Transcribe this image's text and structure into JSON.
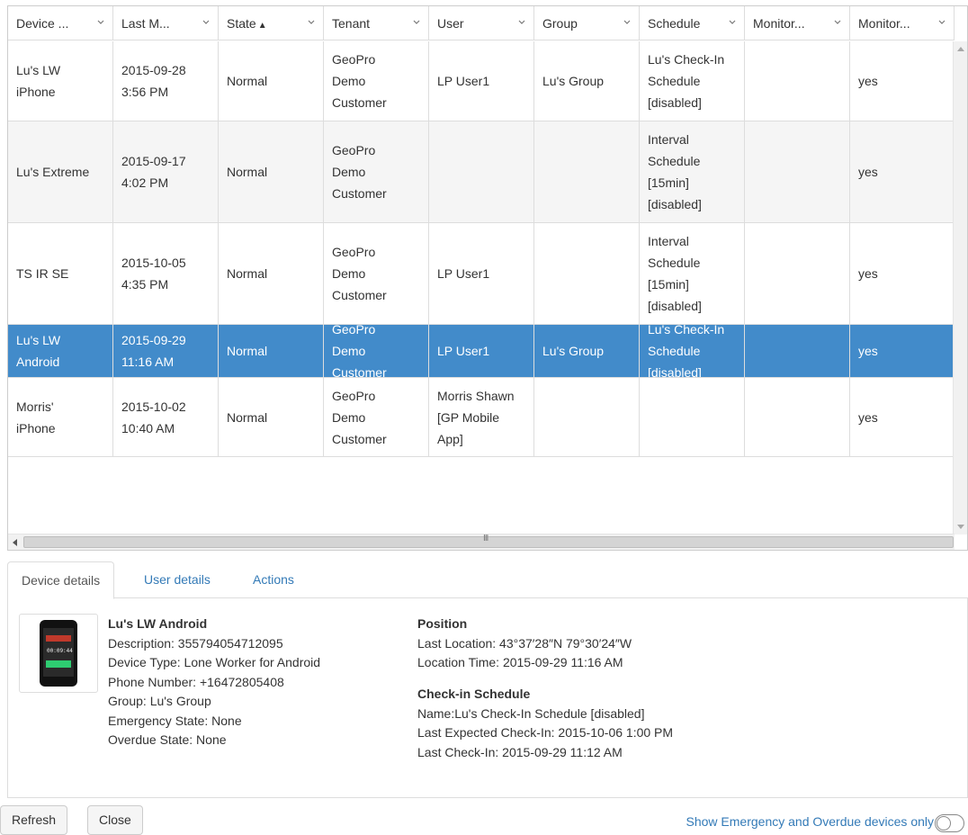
{
  "grid": {
    "columns": [
      {
        "label": "Device ...",
        "sort": ""
      },
      {
        "label": "Last M...",
        "sort": ""
      },
      {
        "label": "State",
        "sort": "▲"
      },
      {
        "label": "Tenant",
        "sort": ""
      },
      {
        "label": "User",
        "sort": ""
      },
      {
        "label": "Group",
        "sort": ""
      },
      {
        "label": "Schedule",
        "sort": ""
      },
      {
        "label": "Monitor...",
        "sort": ""
      },
      {
        "label": "Monitor...",
        "sort": ""
      }
    ],
    "rows": [
      {
        "cells": [
          "Lu's LW\niPhone",
          "2015-09-28\n3:56 PM",
          "Normal",
          "GeoPro\nDemo\nCustomer",
          "LP User1",
          "Lu's Group",
          "Lu's Check-In\nSchedule\n[disabled]",
          "",
          "yes"
        ]
      },
      {
        "cells": [
          "Lu's Extreme",
          "2015-09-17\n4:02 PM",
          "Normal",
          "GeoPro\nDemo\nCustomer",
          "",
          "",
          "Interval\nSchedule\n[15min]\n[disabled]",
          "",
          "yes"
        ]
      },
      {
        "cells": [
          "TS IR SE",
          "2015-10-05\n4:35 PM",
          "Normal",
          "GeoPro\nDemo\nCustomer",
          "LP User1",
          "",
          "Interval\nSchedule\n[15min]\n[disabled]",
          "",
          "yes"
        ]
      },
      {
        "cells": [
          "Lu's LW\nAndroid",
          "2015-09-29\n11:16 AM",
          "Normal",
          "GeoPro\nDemo\nCustomer",
          "LP User1",
          "Lu's Group",
          "Lu's Check-In\nSchedule\n[disabled]",
          "",
          "yes"
        ]
      },
      {
        "cells": [
          "Morris'\niPhone",
          "2015-10-02\n10:40 AM",
          "Normal",
          "GeoPro\nDemo\nCustomer",
          "Morris Shawn\n[GP Mobile\nApp]",
          "",
          "",
          "",
          "yes"
        ]
      }
    ],
    "selected_index": 3,
    "scroll_grip": "III"
  },
  "tabs": [
    "Device details",
    "User details",
    "Actions"
  ],
  "details": {
    "phone_time": "00:09:44",
    "device_name": "Lu's LW Android",
    "device_lines": [
      "Description: 355794054712095",
      "Device Type: Lone Worker for Android",
      "Phone Number: +16472805408",
      "Group: Lu's Group",
      "Emergency State: None",
      "Overdue State: None"
    ],
    "position_title": "Position",
    "position_lines": [
      "Last Location: 43°37′28″N 79°30′24″W",
      "Location Time: 2015-09-29 11:16 AM"
    ],
    "checkin_title": "Check-in Schedule",
    "checkin_lines": [
      "Name:Lu's Check-In Schedule [disabled]",
      "Last Expected Check-In: 2015-10-06 1:00 PM",
      "Last Check-In: 2015-09-29 11:12 AM"
    ]
  },
  "footer": {
    "refresh_label": "Refresh",
    "close_label": "Close",
    "filter_label": "Show Emergency and Overdue devices only"
  }
}
